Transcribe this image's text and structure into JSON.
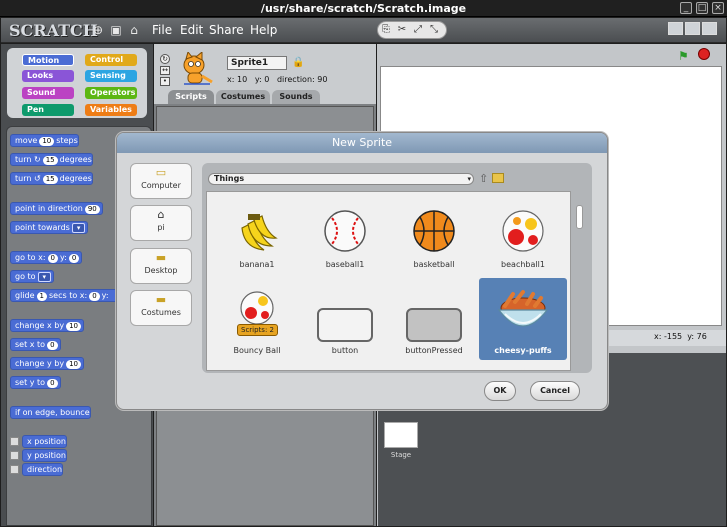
{
  "window": {
    "title": "/usr/share/scratch/Scratch.image"
  },
  "menubar": {
    "logo": "SCRATCH",
    "items": [
      "File",
      "Edit",
      "Share",
      "Help"
    ]
  },
  "categories": [
    {
      "label": "Motion",
      "color": "#4a6cd4"
    },
    {
      "label": "Control",
      "color": "#e1a91a"
    },
    {
      "label": "Looks",
      "color": "#8a55d7"
    },
    {
      "label": "Sensing",
      "color": "#2ca5e2"
    },
    {
      "label": "Sound",
      "color": "#bb42c3"
    },
    {
      "label": "Operators",
      "color": "#5cb712"
    },
    {
      "label": "Pen",
      "color": "#0e9a6c"
    },
    {
      "label": "Variables",
      "color": "#ee7d16"
    }
  ],
  "blocks": {
    "move_a": "move",
    "move_n": "10",
    "move_b": "steps",
    "turn_cw_a": "turn",
    "turn_cw_n": "15",
    "turn_cw_b": "degrees",
    "turn_ccw_a": "turn",
    "turn_ccw_n": "15",
    "turn_ccw_b": "degrees",
    "point_dir_a": "point in direction",
    "point_dir_n": "90",
    "point_towards": "point towards",
    "goto_xy_a": "go to x:",
    "goto_xy_x": "0",
    "goto_xy_b": "y:",
    "goto_xy_y": "0",
    "goto": "go to",
    "glide_a": "glide",
    "glide_n": "1",
    "glide_b": "secs to x:",
    "glide_x": "0",
    "glide_c": "y:",
    "change_x_a": "change x by",
    "change_x_n": "10",
    "set_x_a": "set x to",
    "set_x_n": "0",
    "change_y_a": "change y by",
    "change_y_n": "10",
    "set_y_a": "set y to",
    "set_y_n": "0",
    "bounce": "if on edge, bounce",
    "xpos": "x position",
    "ypos": "y position",
    "direction": "direction"
  },
  "sprite": {
    "name": "Sprite1",
    "x_label": "x:",
    "x": "10",
    "y_label": "y:",
    "y": "0",
    "dir_label": "direction:",
    "dir": "90"
  },
  "tabs": [
    "Scripts",
    "Costumes",
    "Sounds"
  ],
  "stage": {
    "x_label": "x:",
    "x": "-155",
    "y_label": "y:",
    "y": "76",
    "thumb_label": "Stage"
  },
  "dialog": {
    "title": "New Sprite",
    "places": [
      "Computer",
      "pi",
      "Desktop",
      "Costumes"
    ],
    "path": "Things",
    "items": [
      {
        "label": "banana1"
      },
      {
        "label": "baseball1"
      },
      {
        "label": "basketball"
      },
      {
        "label": "beachball1"
      },
      {
        "label": "Bouncy Ball",
        "badge": "Scripts: 2"
      },
      {
        "label": "button"
      },
      {
        "label": "buttonPressed"
      },
      {
        "label": "cheesy-puffs",
        "selected": true
      }
    ],
    "ok": "OK",
    "cancel": "Cancel"
  }
}
